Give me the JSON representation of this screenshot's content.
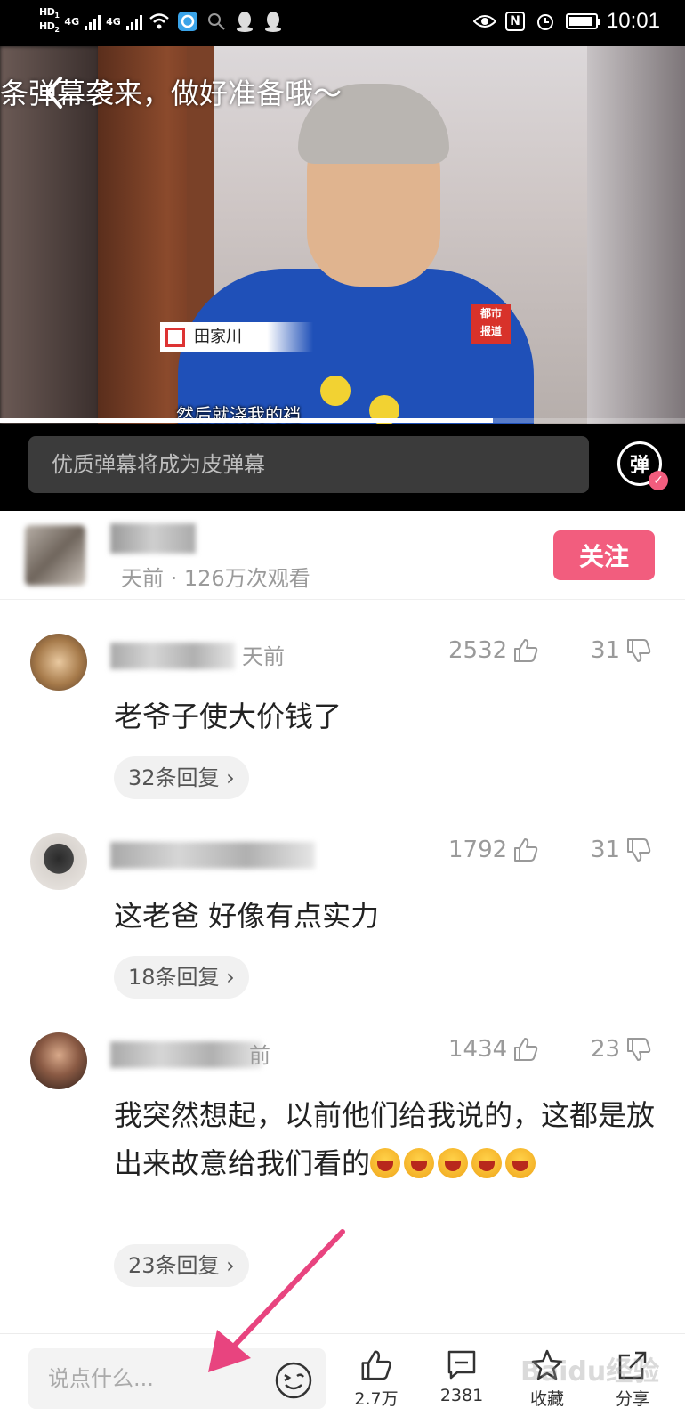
{
  "status_bar": {
    "hd1": "HD",
    "hd1_sub": "1",
    "hd2": "HD",
    "hd2_sub": "2",
    "net1": "4G",
    "net2": "4G",
    "nfc": "N",
    "time": "10:01",
    "icons": [
      "signal-icon",
      "wifi-icon",
      "app-notification-icon",
      "search-notification-icon",
      "qq-icon",
      "qq-icon",
      "eye-icon",
      "nfc-icon",
      "alarm-icon",
      "battery-icon"
    ]
  },
  "video": {
    "danmaku_banner": "条弹幕袭来，做好准备哦～",
    "name_tag": "田家川",
    "subtitle": "然后就浇我的裆",
    "station_logo": "都市\n报道",
    "progress": 0.72
  },
  "danmaku_bar": {
    "placeholder": "优质弹幕将成为皮弹幕",
    "toggle_label": "弹",
    "toggle_check": "✓"
  },
  "uploader": {
    "meta": "天前 · 126万次观看",
    "follow_label": "关注"
  },
  "comments": [
    {
      "time": "天前",
      "likes": "2532",
      "dislikes": "31",
      "text": "老爷子使大价钱了",
      "replies": "32条回复 ›"
    },
    {
      "time": "",
      "likes": "1792",
      "dislikes": "31",
      "text": "这老爸 好像有点实力",
      "replies": "18条回复 ›"
    },
    {
      "time": "前",
      "likes": "1434",
      "dislikes": "23",
      "text": "我突然想起，以前他们给我说的，这都是放出来故意给我们看的",
      "replies": "23条回复 ›"
    }
  ],
  "bottom_bar": {
    "input_placeholder": "说点什么...",
    "like_count": "2.7万",
    "comment_count": "2381",
    "favorite_label": "收藏",
    "share_label": "分享"
  },
  "watermark": "Baidu经验",
  "colors": {
    "accent": "#f25d7e",
    "annotation_arrow": "#e8447f",
    "muted_text": "#9a9a9a"
  }
}
